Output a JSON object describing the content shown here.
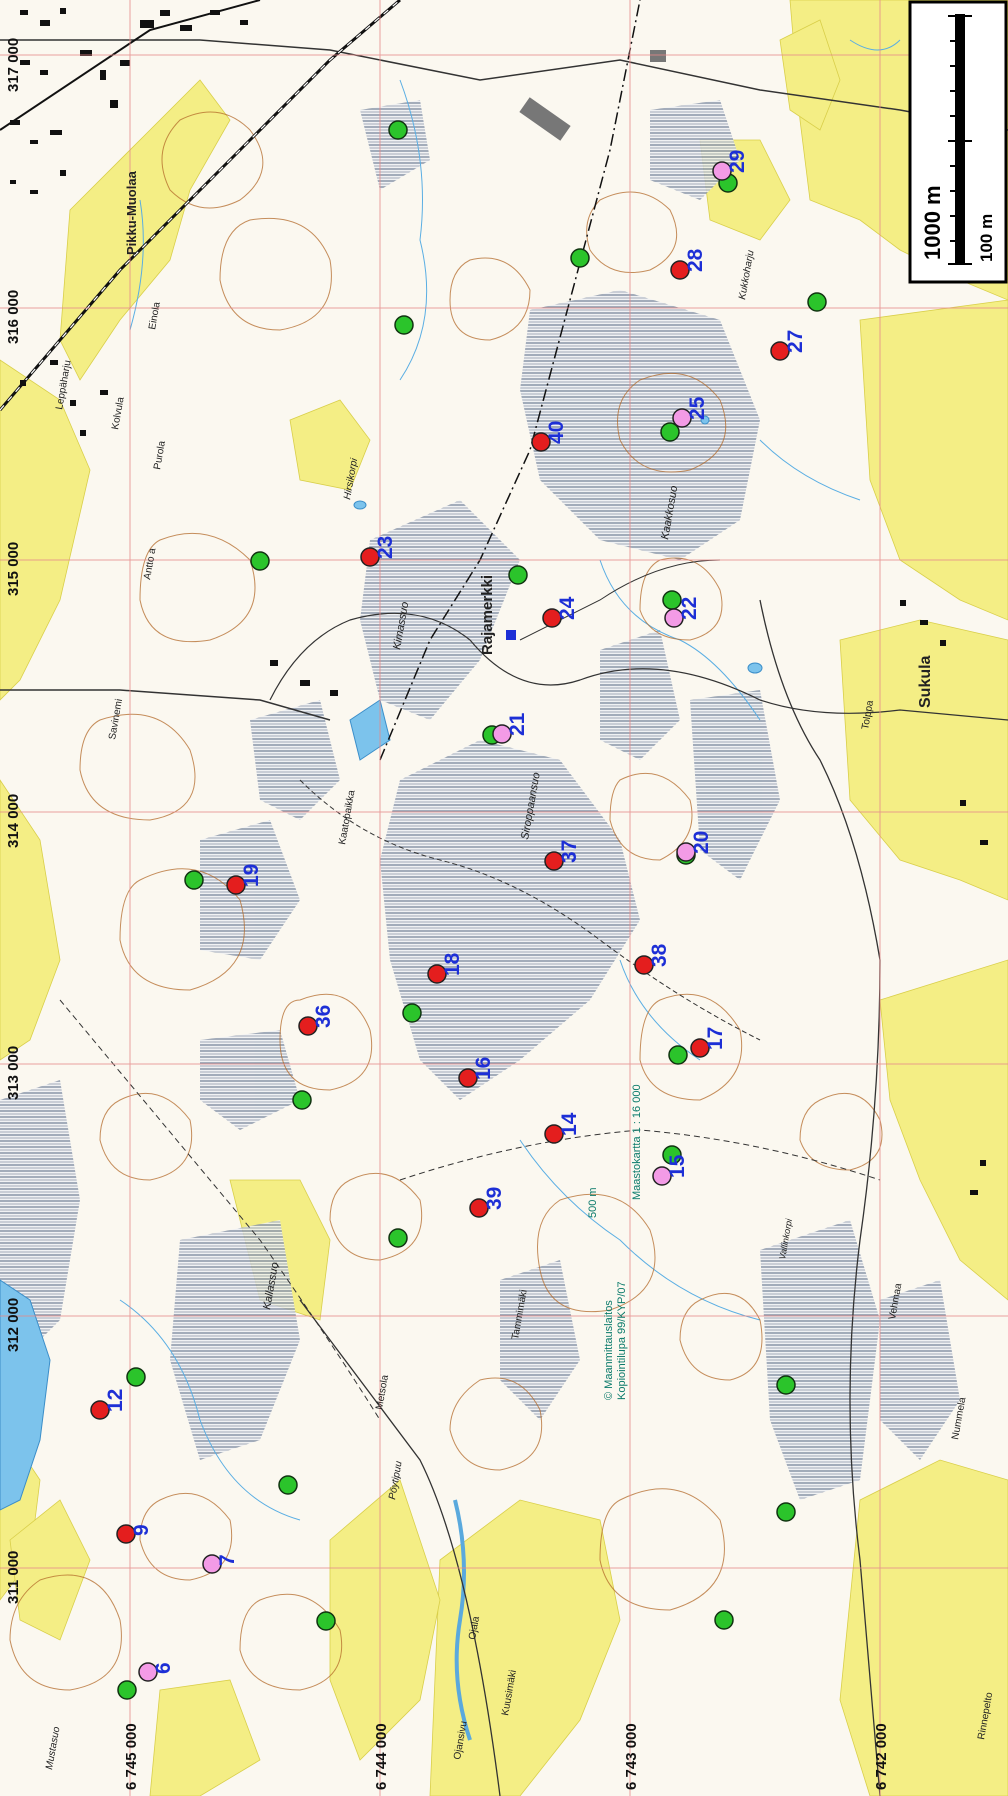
{
  "colors": {
    "background": "#fbf8f0",
    "field": "#f4ee85",
    "bog": "#9aa6b4",
    "contour": "#b36a2a",
    "water": "#67b8e6",
    "grid": "#e08080",
    "marker_red": "#e41e1e",
    "marker_green": "#2bc42b",
    "marker_pink": "#f39be6",
    "marker_label": "#1d2fd6",
    "scalebar": "#000000"
  },
  "scalebar": {
    "label_main": "1000 m",
    "label_minor": "100 m"
  },
  "grid_labels_x": [
    "317 000",
    "316 000",
    "315 000",
    "314 000",
    "313 000",
    "312 000",
    "311 000"
  ],
  "grid_labels_y": [
    "6 745 000",
    "6 744 000",
    "6 743 000",
    "6 742 000"
  ],
  "place_names": {
    "pikku_muolaa": "Pikku-Muolaa",
    "rajamerkki": "Rajamerkki",
    "sukula": "Sukula",
    "kimassuo": "Kimassuo",
    "siroppaansuo": "Siroppaansuo",
    "kaakkosuo": "Kaakkosuo",
    "kukkoharju": "Kukkoharju",
    "kallassuo": "Kallassuo",
    "hirsikorpi": "Hirsikorpi",
    "kaatopaikka": "Kaatopaikka",
    "metsola": "Metsola",
    "poytipuu": "Pöytipuu",
    "kuusimaki": "Kuusimäki",
    "ojansivu": "Ojansivu",
    "tammimaki": "Tammimäki",
    "ojala": "Ojala",
    "mustasuo": "Mustasuo",
    "nummela": "Nummela",
    "rinnepelto": "Rinnepelto",
    "leppaharju": "Leppäharju",
    "kolvula": "Kolvula",
    "purola": "Purola",
    "antto": "Antto a",
    "einola": "Einola",
    "savinemi": "Savinemi",
    "tolppa": "Tolppa",
    "vallinkorpi": "Vallinkorpi",
    "vehmaa": "Vehmaa"
  },
  "map_credits": [
    "© Maanmittauslaitos",
    "Kopiointilupa 99/KYP/07",
    "Maastokartta 1 : 16 000",
    "500 m"
  ],
  "sites": [
    {
      "id": "6",
      "label": "6",
      "color": "pink"
    },
    {
      "id": "7",
      "label": "7",
      "color": "pink"
    },
    {
      "id": "9",
      "label": "9",
      "color": "red"
    },
    {
      "id": "12",
      "label": "12",
      "color": "red"
    },
    {
      "id": "14",
      "label": "14",
      "color": "red"
    },
    {
      "id": "15",
      "label": "15",
      "color": "pink"
    },
    {
      "id": "16",
      "label": "16",
      "color": "red"
    },
    {
      "id": "17",
      "label": "17",
      "color": "red"
    },
    {
      "id": "18",
      "label": "18",
      "color": "red"
    },
    {
      "id": "19",
      "label": "19",
      "color": "red"
    },
    {
      "id": "20",
      "label": "20",
      "color": "pink"
    },
    {
      "id": "21",
      "label": "21",
      "color": "pink"
    },
    {
      "id": "22",
      "label": "22",
      "color": "pink"
    },
    {
      "id": "23",
      "label": "23",
      "color": "red"
    },
    {
      "id": "24",
      "label": "24",
      "color": "red"
    },
    {
      "id": "25",
      "label": "25",
      "color": "pink"
    },
    {
      "id": "27",
      "label": "27",
      "color": "red"
    },
    {
      "id": "28",
      "label": "28",
      "color": "red"
    },
    {
      "id": "29",
      "label": "29",
      "color": "pink"
    },
    {
      "id": "36",
      "label": "36",
      "color": "red"
    },
    {
      "id": "37",
      "label": "37",
      "color": "red"
    },
    {
      "id": "38",
      "label": "38",
      "color": "red"
    },
    {
      "id": "39",
      "label": "39",
      "color": "red"
    },
    {
      "id": "40",
      "label": "40",
      "color": "red"
    }
  ],
  "green_points_count": 24
}
